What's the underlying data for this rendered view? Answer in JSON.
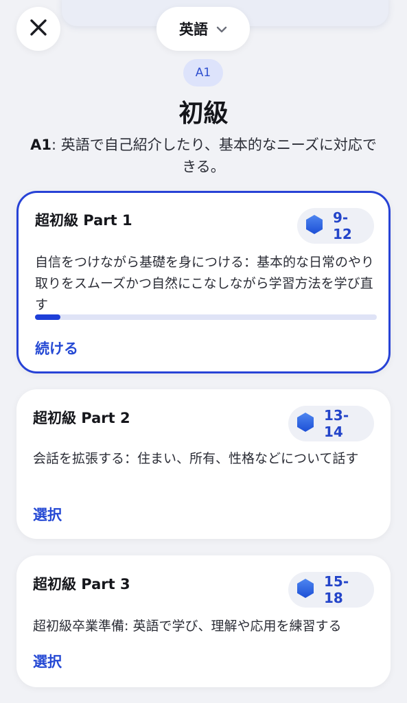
{
  "header": {
    "close_icon": "close-icon",
    "language": "英語",
    "language_chevron_icon": "chevron-down-icon"
  },
  "level": {
    "badge": "A1",
    "title": "初級",
    "desc_code": "A1",
    "desc_text": ": 英語で自己紹介したり、基本的なニーズに対応できる。"
  },
  "courses": [
    {
      "title": "超初級 Part 1",
      "range": "9-12",
      "description": "自信をつけながら基礎を身につける：基本的な日常のやり取りをスムーズかつ自然にこなしながら学習方法を学び直す",
      "progress": 0.075,
      "action": "続ける",
      "active": true,
      "range_icon": "hexagon-icon"
    },
    {
      "title": "超初級 Part 2",
      "range": "13-14",
      "description": "会話を拡張する：住まい、所有、性格などについて話す",
      "action": "選択",
      "active": false,
      "range_icon": "hexagon-icon"
    },
    {
      "title": "超初級 Part 3",
      "range": "15-18",
      "description": "超初級卒業準備: 英語で学び、理解や応用を練習する",
      "action": "選択",
      "active": false,
      "range_icon": "hexagon-icon"
    }
  ],
  "colors": {
    "accent": "#2549d4",
    "active_border": "#2742d6",
    "hexagon_top": "#4e86f0",
    "hexagon_bottom": "#1d4fd6"
  }
}
